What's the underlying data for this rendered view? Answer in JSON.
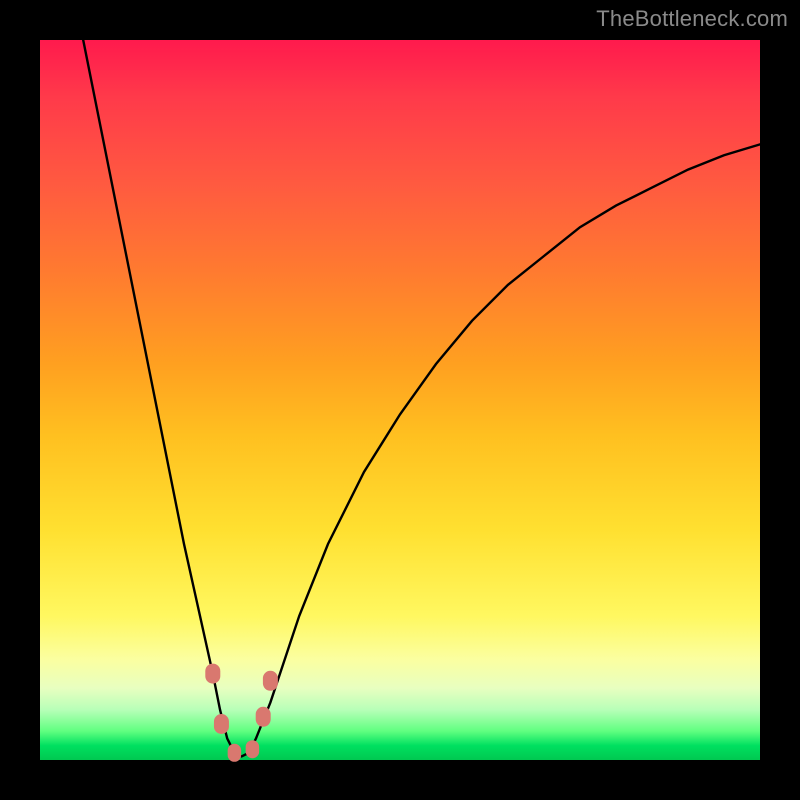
{
  "watermark": {
    "text": "TheBottleneck.com"
  },
  "chart_data": {
    "type": "line",
    "title": "",
    "xlabel": "",
    "ylabel": "",
    "xlim": [
      0,
      100
    ],
    "ylim": [
      0,
      100
    ],
    "grid": false,
    "legend": false,
    "background_gradient": {
      "top_color": "#ff1a4d",
      "mid_upper_color": "#ff8a20",
      "mid_lower_color": "#fff860",
      "bottom_color": "#00c850",
      "meaning": "red=high bottleneck, green=low bottleneck"
    },
    "series": [
      {
        "name": "bottleneck-curve",
        "stroke": "#000000",
        "x": [
          6,
          8,
          10,
          12,
          14,
          16,
          18,
          20,
          22,
          24,
          25,
          26,
          27,
          28,
          29,
          30,
          32,
          34,
          36,
          40,
          45,
          50,
          55,
          60,
          65,
          70,
          75,
          80,
          85,
          90,
          95,
          100
        ],
        "y": [
          100,
          90,
          80,
          70,
          60,
          50,
          40,
          30,
          21,
          12,
          7,
          3,
          1,
          0.5,
          1,
          3,
          8,
          14,
          20,
          30,
          40,
          48,
          55,
          61,
          66,
          70,
          74,
          77,
          79.5,
          82,
          84,
          85.5
        ]
      }
    ],
    "markers": [
      {
        "name": "left-upper-marker",
        "x": 24.0,
        "y": 12,
        "color": "#d9786f",
        "r": 10
      },
      {
        "name": "left-lower-marker",
        "x": 25.2,
        "y": 5,
        "color": "#d9786f",
        "r": 10
      },
      {
        "name": "bottom-marker-1",
        "x": 27.0,
        "y": 1,
        "color": "#d9786f",
        "r": 9
      },
      {
        "name": "bottom-marker-2",
        "x": 29.5,
        "y": 1.5,
        "color": "#d9786f",
        "r": 9
      },
      {
        "name": "right-lower-marker",
        "x": 31.0,
        "y": 6,
        "color": "#d9786f",
        "r": 10
      },
      {
        "name": "right-upper-marker",
        "x": 32.0,
        "y": 11,
        "color": "#d9786f",
        "r": 10
      }
    ],
    "minimum_at_x": 28
  }
}
